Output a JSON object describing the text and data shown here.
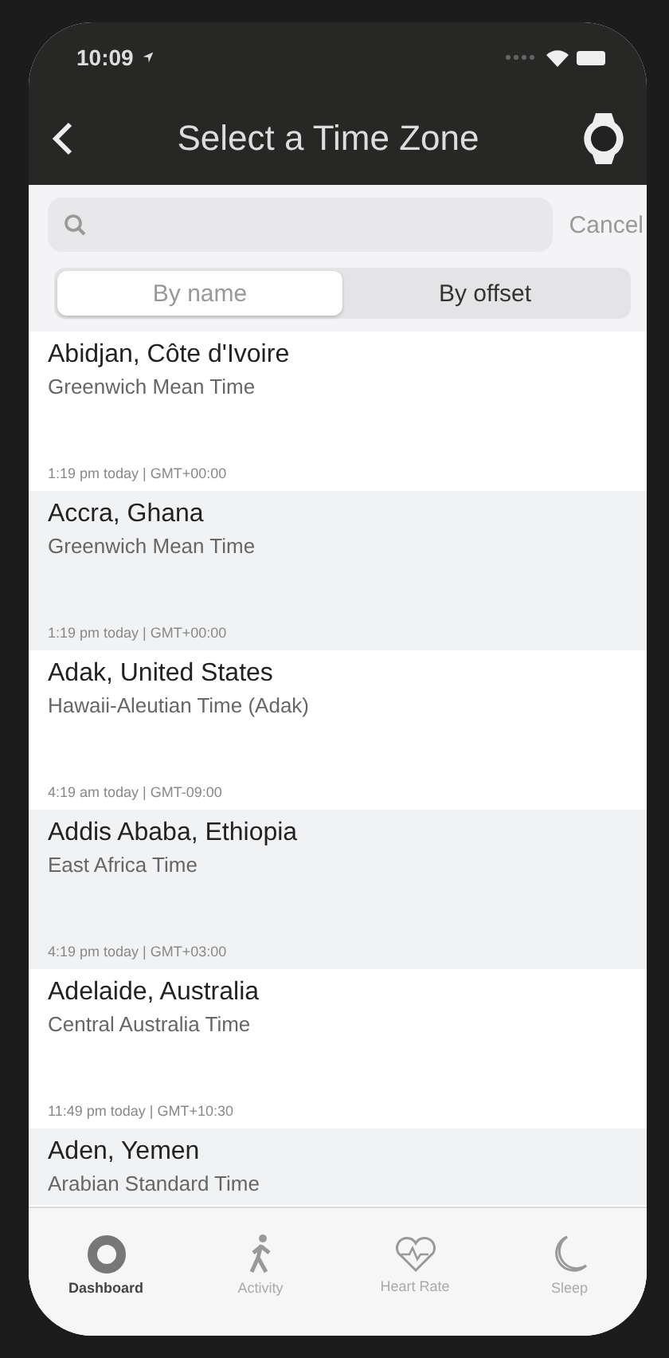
{
  "status_bar": {
    "time": "10:09"
  },
  "nav": {
    "title": "Select a Time Zone"
  },
  "search": {
    "cancel": "Cancel"
  },
  "segments": [
    {
      "label": "By name",
      "selected": true
    },
    {
      "label": "By offset",
      "selected": false
    }
  ],
  "zones": [
    {
      "city": "Abidjan, Côte d'Ivoire",
      "zone": "Greenwich Mean Time",
      "time": "1:19 pm today | GMT+00:00"
    },
    {
      "city": "Accra, Ghana",
      "zone": "Greenwich Mean Time",
      "time": "1:19 pm today | GMT+00:00"
    },
    {
      "city": "Adak, United States",
      "zone": "Hawaii-Aleutian Time (Adak)",
      "time": "4:19 am today | GMT-09:00"
    },
    {
      "city": "Addis Ababa, Ethiopia",
      "zone": "East Africa Time",
      "time": "4:19 pm today | GMT+03:00"
    },
    {
      "city": "Adelaide, Australia",
      "zone": "Central Australia Time",
      "time": "11:49 pm today | GMT+10:30"
    },
    {
      "city": "Aden, Yemen",
      "zone": "Arabian Standard Time"
    }
  ],
  "tabs": [
    {
      "label": "Dashboard",
      "kind": "dashboard",
      "selected": true
    },
    {
      "label": "Activity",
      "kind": "activity",
      "selected": false
    },
    {
      "label": "Heart Rate",
      "kind": "heart",
      "selected": false
    },
    {
      "label": "Sleep",
      "kind": "sleep",
      "selected": false
    }
  ]
}
